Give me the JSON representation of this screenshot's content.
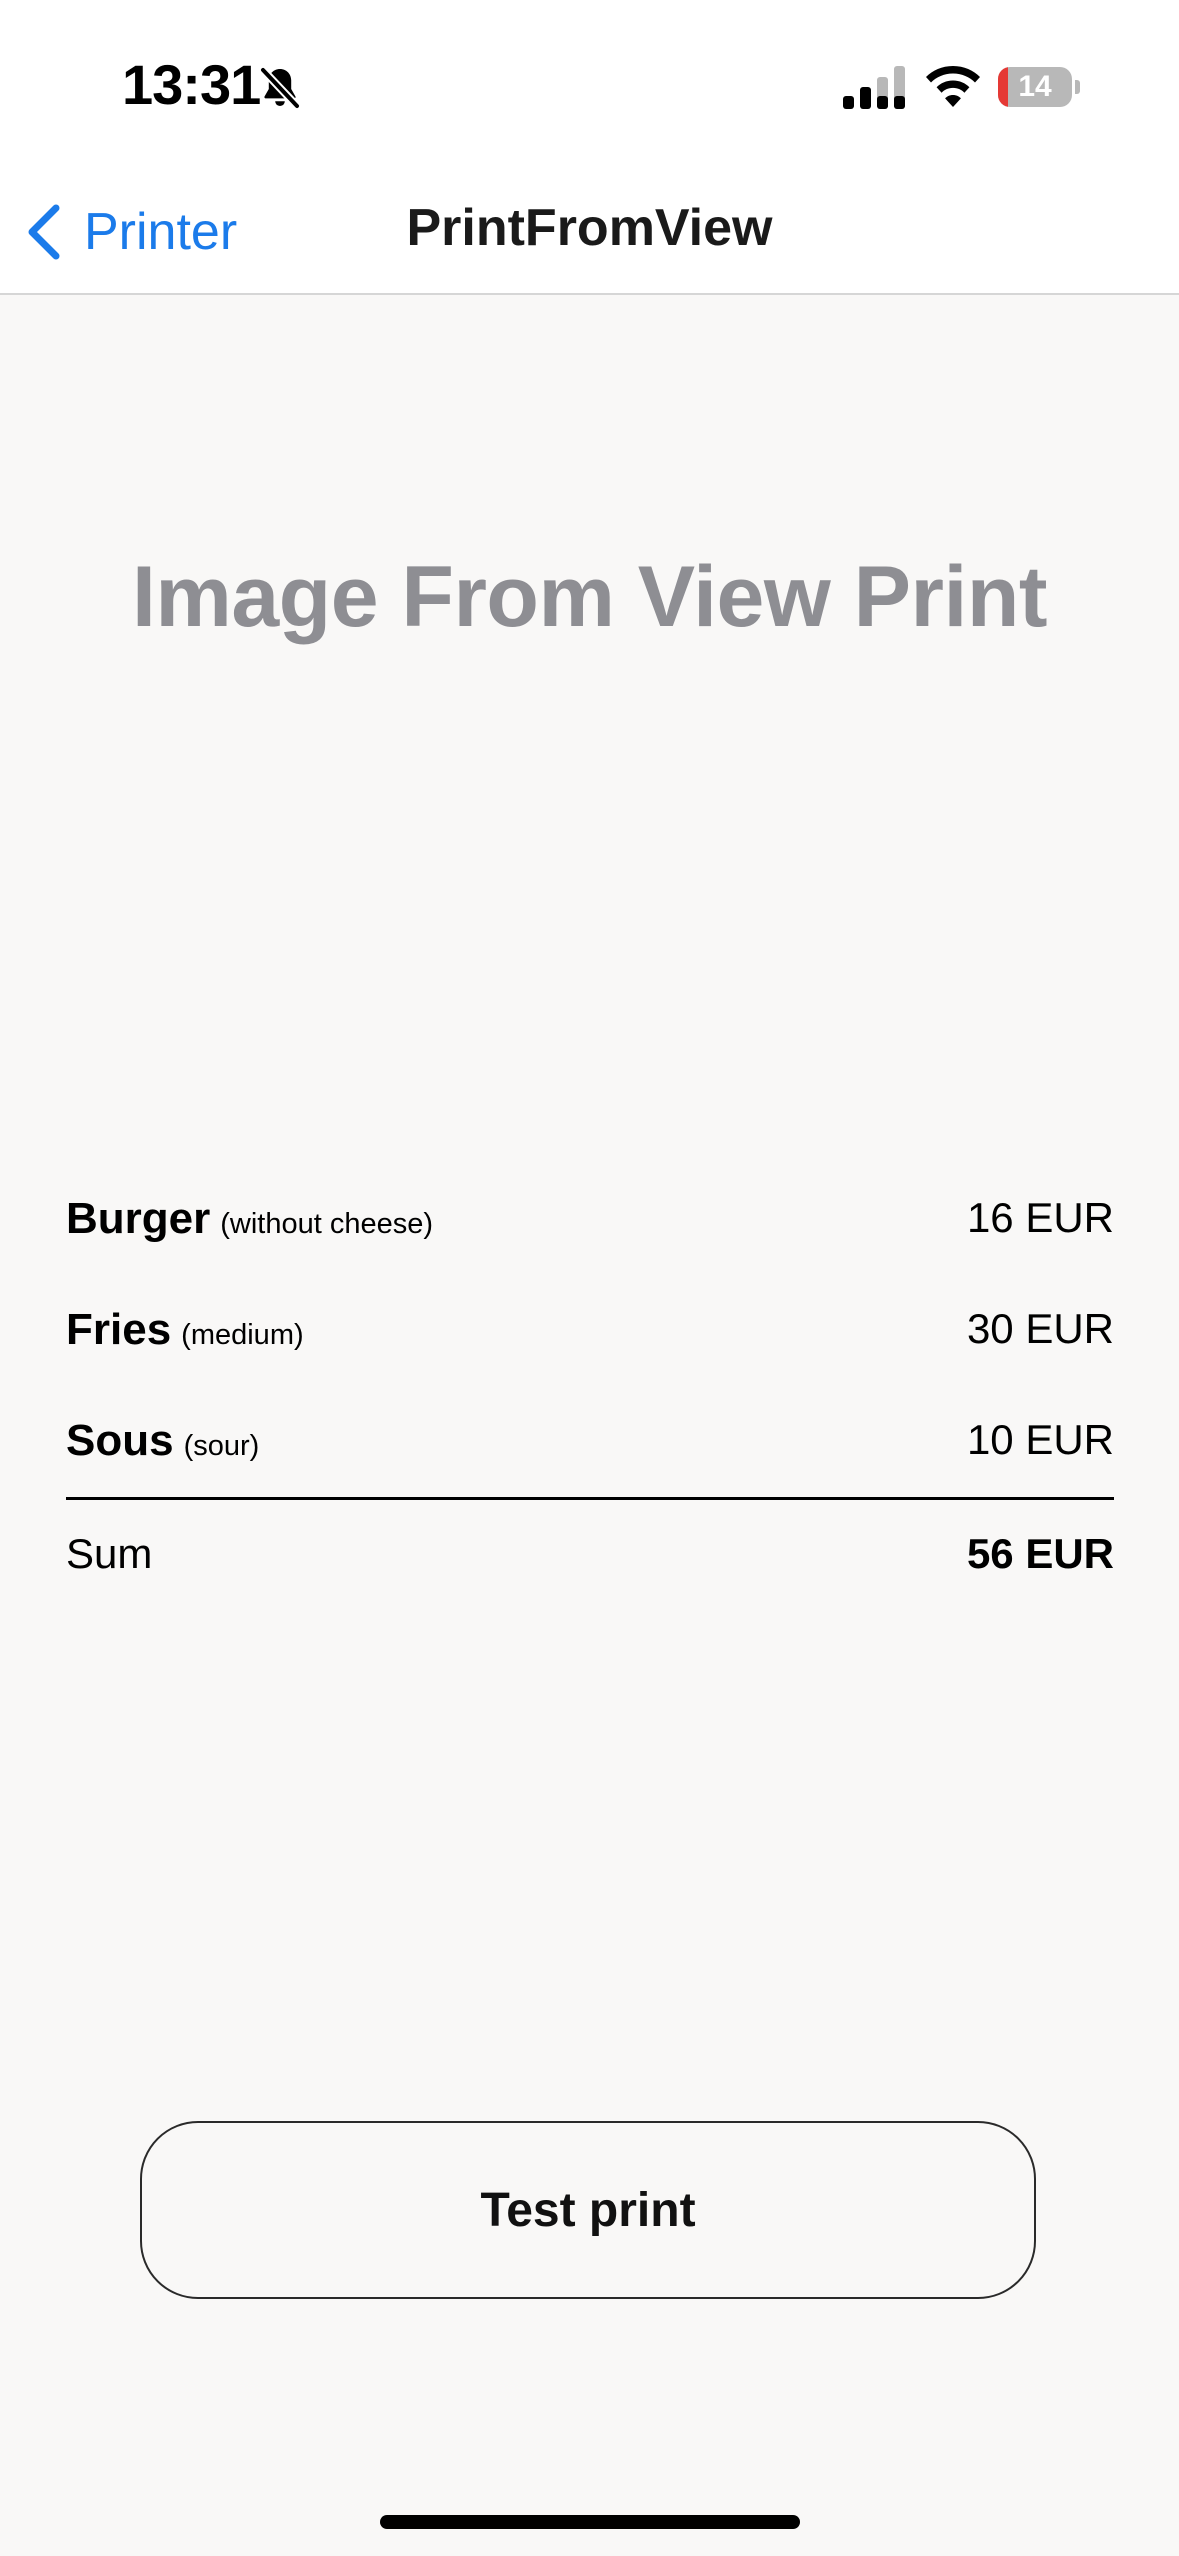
{
  "status_bar": {
    "time": "13:31",
    "battery_level": "14",
    "battery_fraction": 0.14,
    "icons": [
      "bell-slash-icon",
      "cellular-signal-icon",
      "wifi-icon",
      "battery-icon"
    ]
  },
  "nav": {
    "back_label": "Printer",
    "back_icon": "chevron-left-icon",
    "title": "PrintFromView"
  },
  "headline": "Image From View Print",
  "receipt": {
    "items": [
      {
        "name": "Burger",
        "note": "(without cheese)",
        "price": "16 EUR"
      },
      {
        "name": "Fries",
        "note": "(medium)",
        "price": "30 EUR"
      },
      {
        "name": "Sous",
        "note": "(sour)",
        "price": "10 EUR"
      }
    ],
    "sum_label": "Sum",
    "sum_value": "56 EUR"
  },
  "actions": {
    "test_print_label": "Test print"
  },
  "colors": {
    "accent": "#1b7bea",
    "background": "#f9f8f7",
    "headline": "#8e8e93",
    "battery_low": "#e53935"
  }
}
